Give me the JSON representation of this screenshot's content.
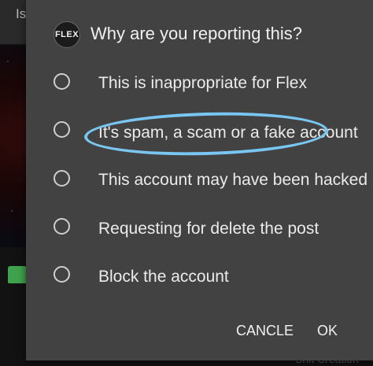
{
  "background": {
    "app_title": "Is",
    "footer_text": "Shit Creation"
  },
  "dialog": {
    "logo_text": "FLEX",
    "title": "Why are you reporting this?",
    "options": [
      {
        "label": "This is inappropriate for Flex",
        "selected": false
      },
      {
        "label": "It's spam, a scam or a fake account",
        "selected": false,
        "circled": true
      },
      {
        "label": "This account may have been hacked",
        "selected": false
      },
      {
        "label": "Requesting for delete the post",
        "selected": false
      },
      {
        "label": "Block the account",
        "selected": false
      }
    ],
    "cancel_label": "CANCLE",
    "ok_label": "OK"
  },
  "colors": {
    "dialog_bg": "#424242",
    "text": "#ebebeb",
    "highlight": "#79c6f2",
    "like_green": "#3fa34d"
  }
}
